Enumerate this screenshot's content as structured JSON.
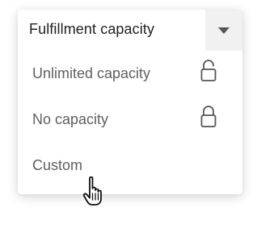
{
  "dropdown": {
    "title": "Fulfillment capacity",
    "toggle_icon": "caret-down-icon",
    "options": [
      {
        "label": "Unlimited capacity",
        "icon": "unlocked-icon"
      },
      {
        "label": "No capacity",
        "icon": "locked-icon"
      },
      {
        "label": "Custom"
      }
    ]
  },
  "cursor": {
    "icon": "hand-pointer-icon"
  }
}
